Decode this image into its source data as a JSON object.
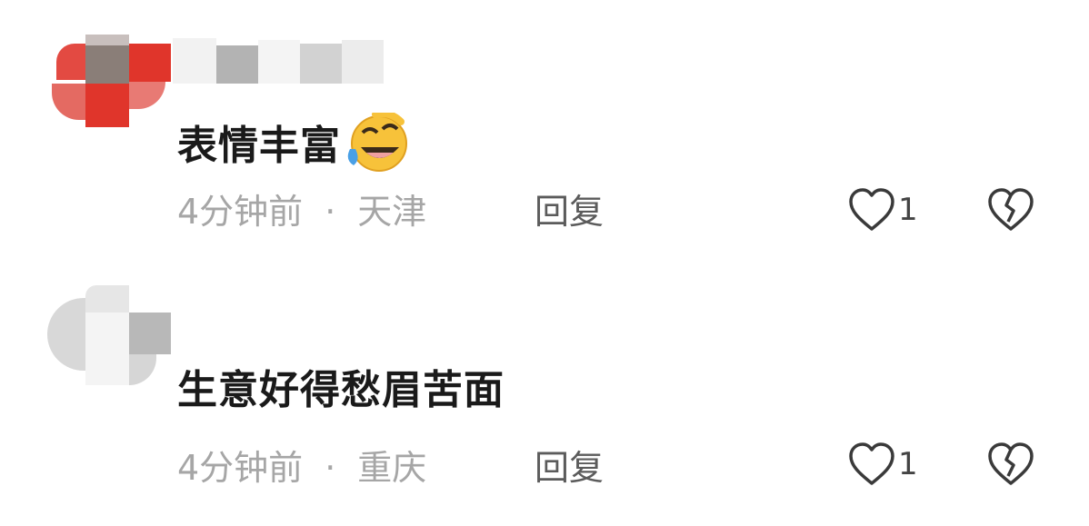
{
  "comments": [
    {
      "text": "表情丰富",
      "emoji": "laughing-face-emoji",
      "time": "4分钟前",
      "separator": "·",
      "location": "天津",
      "reply_label": "回复",
      "like_count": "1"
    },
    {
      "text": "生意好得愁眉苦面",
      "time": "4分钟前",
      "separator": "·",
      "location": "重庆",
      "reply_label": "回复",
      "like_count": "1"
    }
  ],
  "colors": {
    "text": "#1a1a1a",
    "meta": "#a6a6a6",
    "reply": "#5b5b5b",
    "avatar1": "#e0352b",
    "mosaic_gray": "#b8b8b8"
  }
}
